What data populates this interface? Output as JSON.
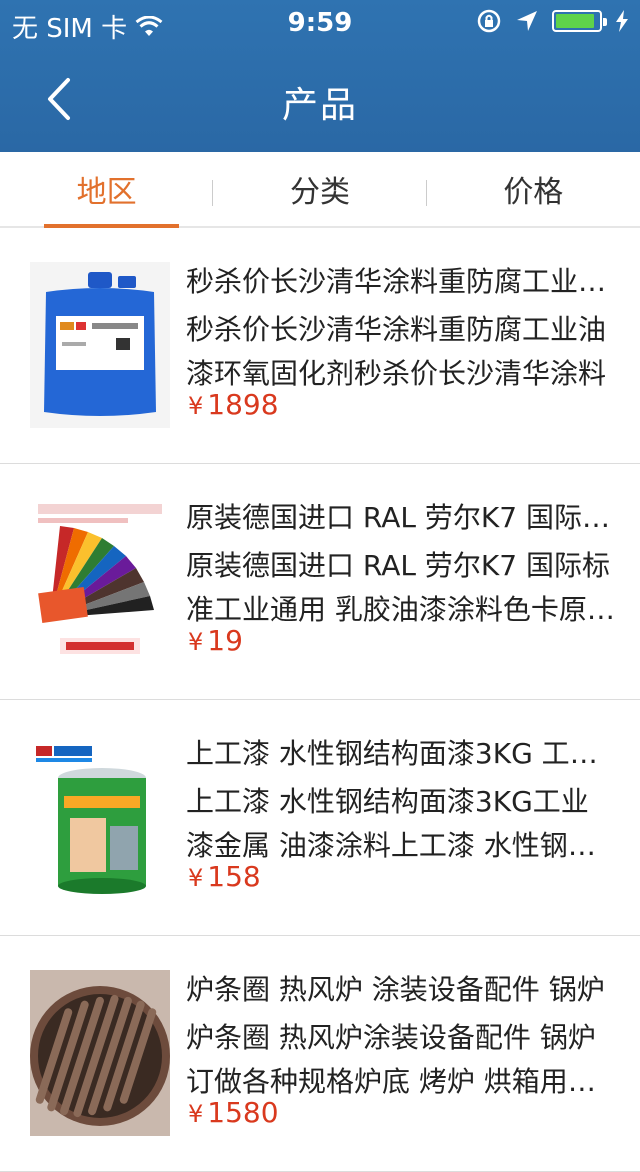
{
  "status_bar": {
    "carrier": "无 SIM 卡",
    "time": "9:59",
    "battery_color": "#5fd34a"
  },
  "nav": {
    "title": "产品",
    "back_icon": "chevron-left-icon"
  },
  "tabs": [
    {
      "label": "地区",
      "active": true
    },
    {
      "label": "分类",
      "active": false
    },
    {
      "label": "价格",
      "active": false
    }
  ],
  "colors": {
    "header": "#2f73b1",
    "accent": "#e2712d",
    "price": "#d9391e"
  },
  "products": [
    {
      "name": "秒杀价长沙清华涂料重防腐工业油漆环氧固化剂秒杀价长沙清华涂料",
      "desc": "秒杀价长沙清华涂料重防腐工业油漆环氧固化剂秒杀价长沙清华涂料",
      "currency": "¥",
      "price": "1898"
    },
    {
      "name": "原装德国进口 RAL 劳尔K7 国际标准工业通用",
      "desc": "原装德国进口 RAL 劳尔K7 国际标准工业通用 乳胶油漆涂料色卡原装正版",
      "currency": "¥",
      "price": "19"
    },
    {
      "name": "上工漆 水性钢结构面漆3KG 工业漆",
      "desc": "上工漆 水性钢结构面漆3KG工业漆金属 油漆涂料上工漆 水性钢结构面漆",
      "currency": "¥",
      "price": "158"
    },
    {
      "name": "炉条圈 热风炉 涂装设备配件 锅炉",
      "desc": "炉条圈 热风炉涂装设备配件 锅炉订做各种规格炉底 烤炉 烘箱用配件",
      "currency": "¥",
      "price": "1580"
    }
  ]
}
